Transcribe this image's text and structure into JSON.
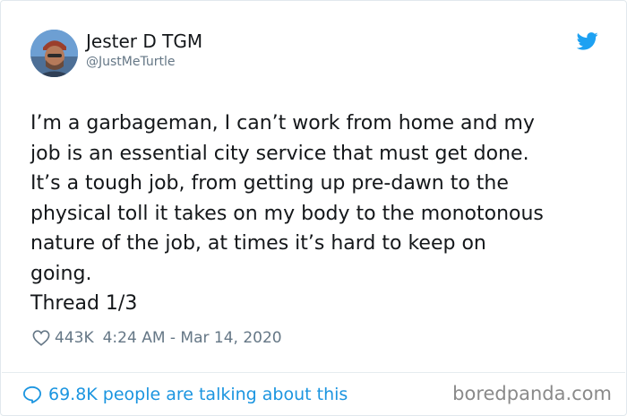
{
  "tweet": {
    "author": {
      "display_name": "Jester D TGM",
      "handle": "@JustMeTurtle"
    },
    "text_lines": [
      "I’m a garbageman, I can’t work from home and my",
      "job is an essential city service that must get done.",
      "It’s a tough job, from getting up pre-dawn to the",
      "physical toll it takes on my body to the monotonous",
      "nature of the job, at times it’s hard to keep on",
      "going.",
      "Thread 1/3"
    ],
    "likes": "443K",
    "timestamp": "4:24 AM - Mar 14, 2020"
  },
  "footer": {
    "count": "69.8K",
    "talking_text": "people are talking about this"
  },
  "watermark": "boredpanda.com",
  "icons": {
    "brand": "twitter-bird-icon",
    "like": "heart-icon",
    "reply": "speech-bubble-icon"
  },
  "colors": {
    "twitter_blue": "#1da1f2",
    "link_blue": "#1b95e0",
    "secondary_text": "#657786",
    "primary_text": "#14171a"
  }
}
